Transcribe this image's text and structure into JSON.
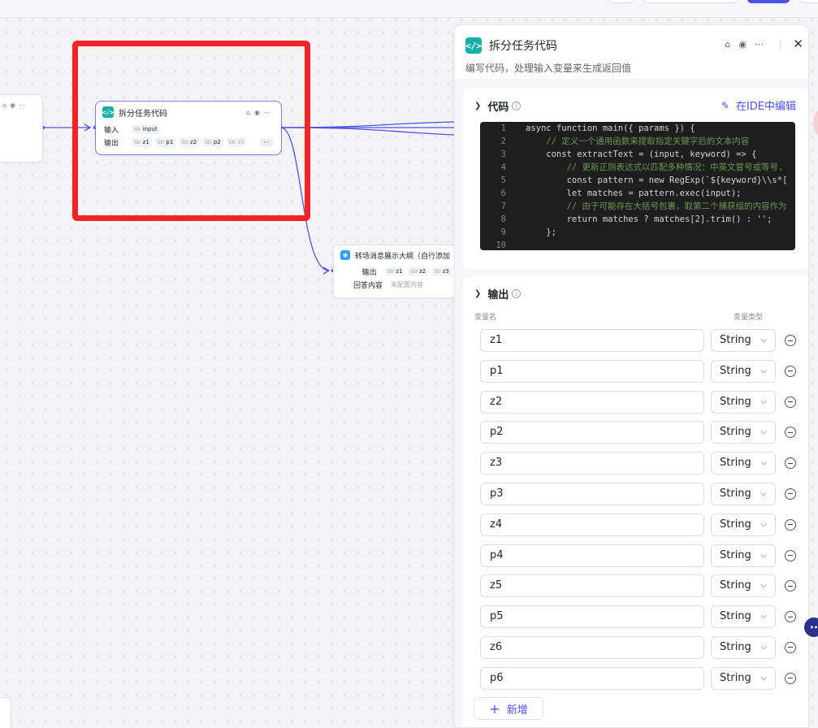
{
  "canvas": {
    "main_node": {
      "title": "拆分任务代码",
      "input_label": "输入",
      "output_label": "输出",
      "inputs": [
        {
          "type": "Str",
          "name": "input"
        }
      ],
      "outputs": [
        {
          "type": "Str",
          "name": "z1"
        },
        {
          "type": "Str",
          "name": "p1"
        },
        {
          "type": "Str",
          "name": "z2"
        },
        {
          "type": "Str",
          "name": "p2"
        },
        {
          "type": "Str",
          "name": "z3"
        }
      ],
      "more": "···"
    },
    "reply_node": {
      "title": "转场消息展示大纲（自行添加",
      "output_label": "输出",
      "outputs": [
        {
          "type": "Str",
          "name": "z1"
        },
        {
          "type": "Str",
          "name": "z2"
        },
        {
          "type": "Str",
          "name": "z3"
        }
      ],
      "reply_label": "回答内容",
      "reply_value": "未配置内容"
    }
  },
  "panel": {
    "title": "拆分任务代码",
    "description": "编写代码，处理输入变量来生成返回值",
    "code_section": {
      "title": "代码",
      "ide_link": "在IDE中编辑",
      "lines": [
        {
          "n": "1",
          "text": "async function main({ params }) {"
        },
        {
          "n": "2",
          "text": "    // 定义一个通用函数来提取指定关键字后的文本内容"
        },
        {
          "n": "3",
          "text": "    const extractText = (input, keyword) => {"
        },
        {
          "n": "4",
          "text": "        // 更新正则表达式以匹配多种情况：中英文冒号或等号,"
        },
        {
          "n": "5",
          "text": "        const pattern = new RegExp(`${keyword}\\\\s*["
        },
        {
          "n": "6",
          "text": "        let matches = pattern.exec(input);"
        },
        {
          "n": "7",
          "text": "        // 由于可能存在大括号包裹，取第二个捕获组的内容作为"
        },
        {
          "n": "8",
          "text": "        return matches ? matches[2].trim() : '';"
        },
        {
          "n": "9",
          "text": "    };"
        },
        {
          "n": "10",
          "text": ""
        }
      ]
    },
    "output_section": {
      "title": "输出",
      "col_name": "变量名",
      "col_type": "变量类型",
      "rows": [
        {
          "name": "z1",
          "type": "String"
        },
        {
          "name": "p1",
          "type": "String"
        },
        {
          "name": "z2",
          "type": "String"
        },
        {
          "name": "p2",
          "type": "String"
        },
        {
          "name": "z3",
          "type": "String"
        },
        {
          "name": "p3",
          "type": "String"
        },
        {
          "name": "z4",
          "type": "String"
        },
        {
          "name": "p4",
          "type": "String"
        },
        {
          "name": "z5",
          "type": "String"
        },
        {
          "name": "p5",
          "type": "String"
        },
        {
          "name": "z6",
          "type": "String"
        },
        {
          "name": "p6",
          "type": "String"
        }
      ],
      "add_label": "新增"
    }
  },
  "colors": {
    "accent": "#4d53e8",
    "code_icon": "#17b1a8",
    "highlight_box": "#f02424"
  }
}
